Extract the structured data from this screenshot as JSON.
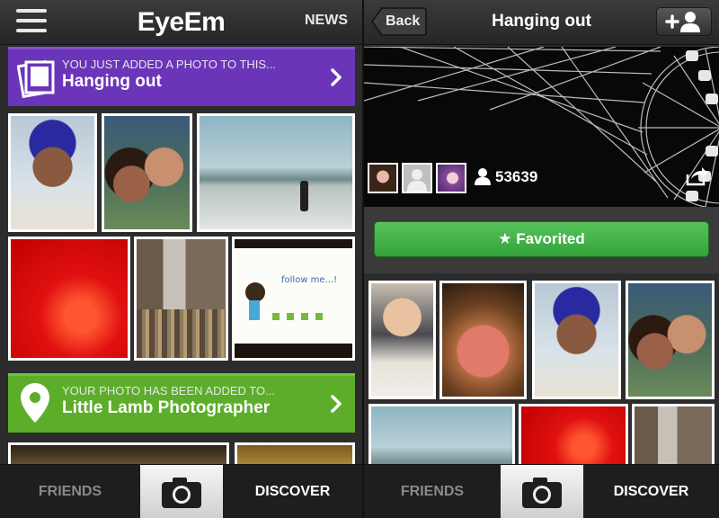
{
  "left": {
    "header": {
      "logo": "EyeEm",
      "news_label": "NEWS"
    },
    "banner1": {
      "subtitle": "YOU JUST ADDED A PHOTO TO THIS...",
      "title": "Hanging out"
    },
    "banner2": {
      "subtitle": "YOUR PHOTO HAS BEEN ADDED TO...",
      "title": "Little Lamb Photographer"
    },
    "photos": {
      "follow_text": "follow me...!"
    },
    "bottom": {
      "friends": "FRIENDS",
      "discover": "DISCOVER"
    }
  },
  "right": {
    "header": {
      "back_label": "Back",
      "title": "Hanging out"
    },
    "hero": {
      "people_count": "53639"
    },
    "favorited_label": "★ Favorited",
    "bottom": {
      "friends": "FRIENDS",
      "discover": "DISCOVER"
    }
  },
  "colors": {
    "purple_banner": "#6a35b8",
    "green_banner": "#5cae2a",
    "favorited_green": "#3bb041"
  },
  "icons": [
    "hamburger-icon",
    "photo-stack-icon",
    "chevron-right-icon",
    "map-pin-icon",
    "camera-icon",
    "person-icon",
    "share-icon",
    "add-friend-icon"
  ]
}
